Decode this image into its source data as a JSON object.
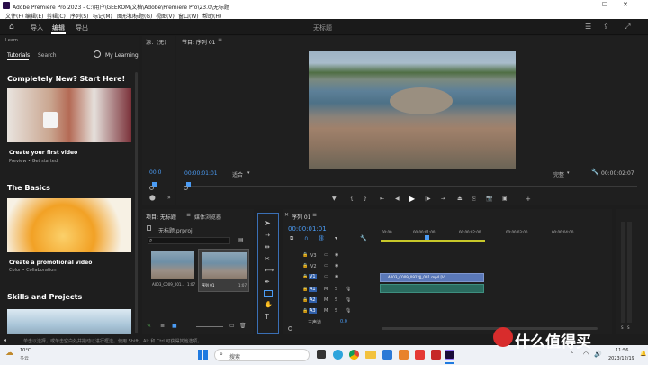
{
  "titlebar": {
    "title": "Adobe Premiere Pro 2023 - C:\\用户\\GEEKOM\\文档\\Adobe\\Premiere Pro\\23.0\\无标题"
  },
  "menu": [
    "文件(F)",
    "编辑(E)",
    "剪辑(C)",
    "序列(S)",
    "标记(M)",
    "图形和标题(G)",
    "视图(V)",
    "窗口(W)",
    "帮助(H)"
  ],
  "header": {
    "tabs": [
      "导入",
      "编辑",
      "导出"
    ],
    "active_tab": 1,
    "project_title": "无标题"
  },
  "learn": {
    "panel_title": "Learn",
    "tabs": [
      "Tutorials",
      "Search"
    ],
    "my_learning": "My Learning",
    "sections": [
      {
        "title": "Completely New? Start Here!",
        "card_title": "Create your first video",
        "card_meta": "Preview  •  Get started"
      },
      {
        "title": "The Basics",
        "card_title": "Create a promotional video",
        "card_meta": "Color  •  Collaboration"
      },
      {
        "title": "Skills and Projects",
        "card_title": "",
        "card_meta": ""
      }
    ]
  },
  "source_monitor": {
    "label": "源：(无)",
    "timecode": "00:0"
  },
  "program_monitor": {
    "tab": "节目: 序列 01",
    "timecode_left": "00:00:01:01",
    "fit": "适合",
    "quality": "完整",
    "timecode_right": "00:00:02:07"
  },
  "project": {
    "tabs": [
      "项目: 无标题",
      "媒体浏览器"
    ],
    "file_name": "无标题.prproj",
    "items": [
      {
        "name": "A003_C009_001...",
        "duration": "1:07"
      },
      {
        "name": "序列 01",
        "duration": "1:07"
      }
    ]
  },
  "timeline": {
    "tab": "序列 01",
    "timecode": "00:00:01:01",
    "ruler": [
      "00:00",
      "00:00:01:00",
      "00:00:02:00",
      "00:00:03:00",
      "00:00:04:00"
    ],
    "video_tracks": [
      "V3",
      "V2",
      "V1"
    ],
    "audio_tracks": [
      "A1",
      "A2",
      "A3"
    ],
    "clip_label": "A003_C009_0922JJ_001.mp4 [V]",
    "master": "主声道",
    "master_value": "0.0"
  },
  "status": {
    "text": "单击以选择，或单击空白处并拖动以进行框选。使用 Shift、Alt 和 Ctrl 可获得其他选项。"
  },
  "taskbar": {
    "weather_temp": "10°C",
    "weather_text": "多云",
    "search_placeholder": "搜索",
    "time": "11:56",
    "date": "2023/12/19"
  },
  "watermark": {
    "text": "什么值得买"
  }
}
